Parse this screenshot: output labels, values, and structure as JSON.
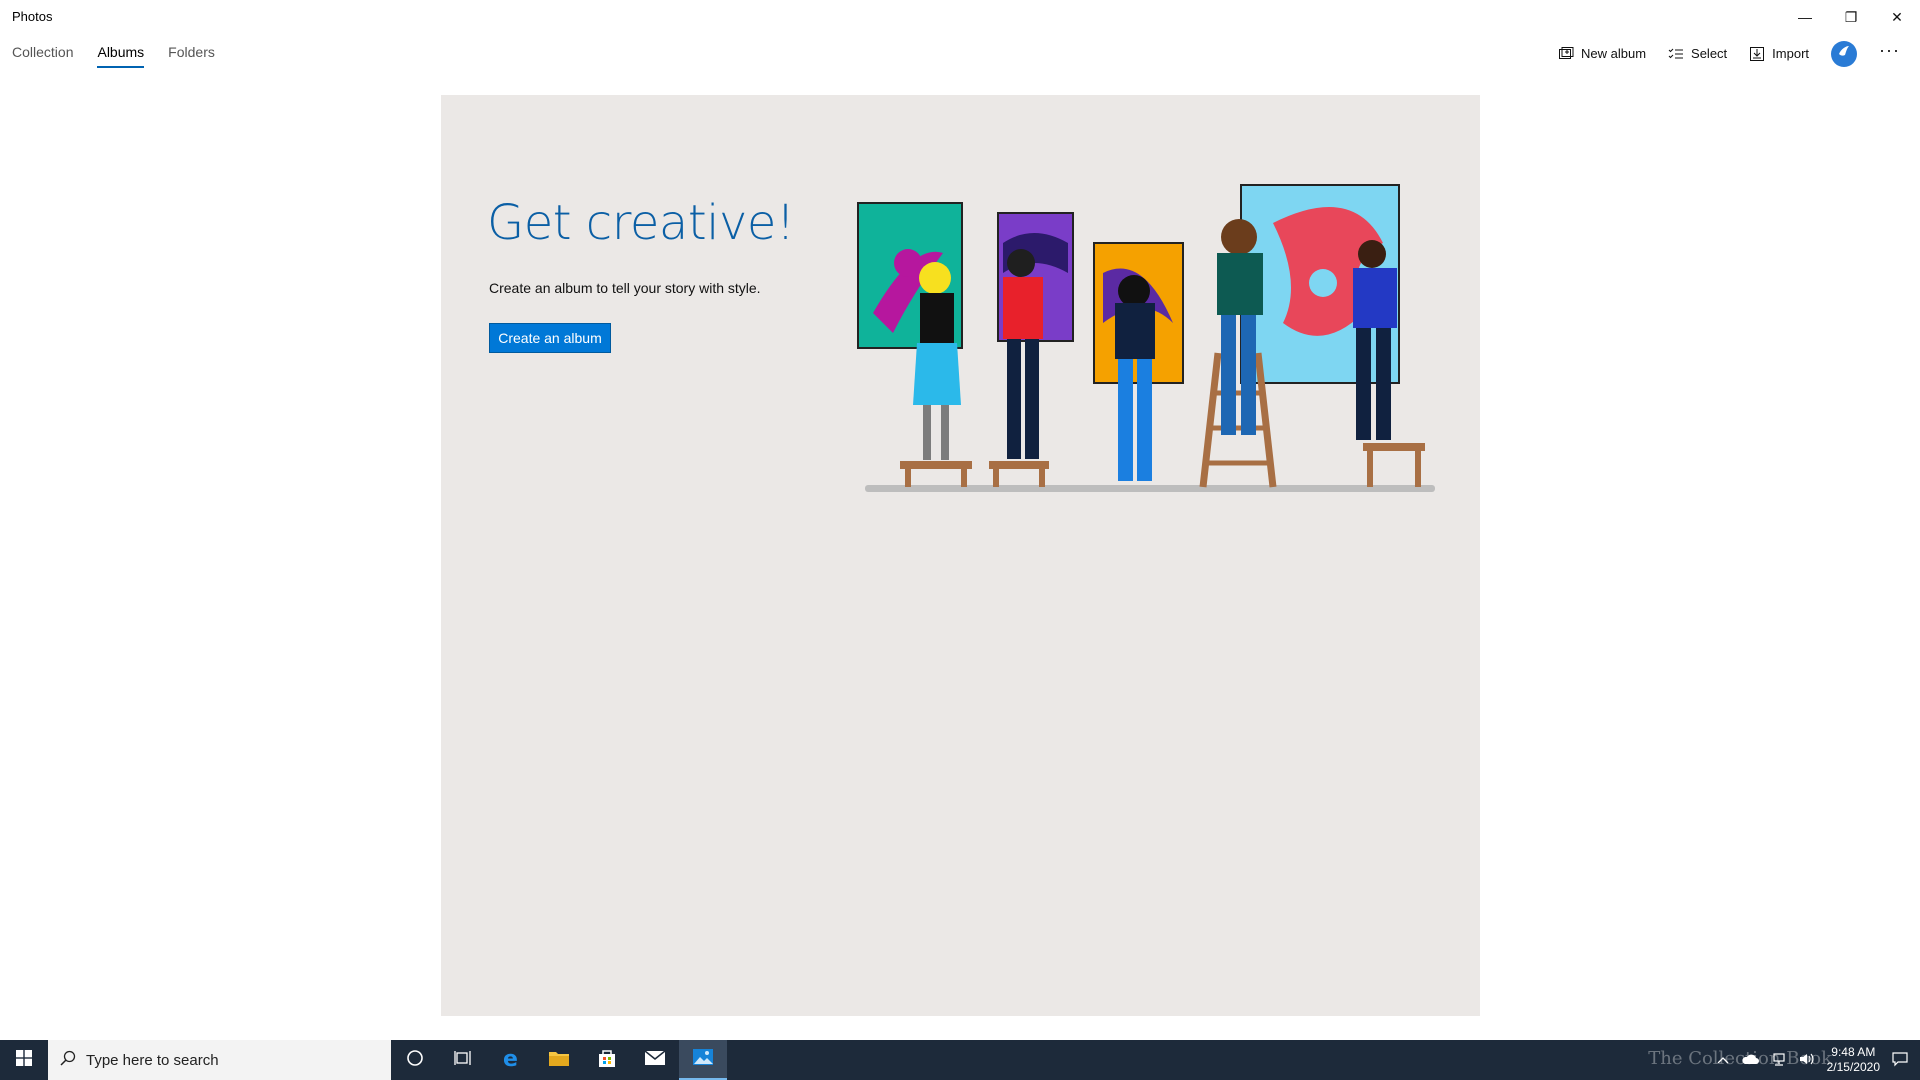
{
  "window": {
    "title": "Photos",
    "controls": {
      "minimize": "—",
      "maximize": "❐",
      "close": "✕"
    }
  },
  "tabs": [
    {
      "label": "Collection",
      "active": false
    },
    {
      "label": "Albums",
      "active": true
    },
    {
      "label": "Folders",
      "active": false
    }
  ],
  "toolbar": {
    "new_album": "New album",
    "select": "Select",
    "import": "Import",
    "more": "···"
  },
  "empty_state": {
    "headline": "Get creative!",
    "description": "Create an album to tell your story with style.",
    "button": "Create an album"
  },
  "taskbar": {
    "search_placeholder": "Type here to search",
    "time": "9:48 AM",
    "date": "2/15/2020",
    "watermark": "The Collection Book"
  },
  "colors": {
    "accent": "#0078d7",
    "headline": "#0b5fa5",
    "panel_bg": "#ebe8e6",
    "taskbar_bg": "#1d2a3a"
  }
}
